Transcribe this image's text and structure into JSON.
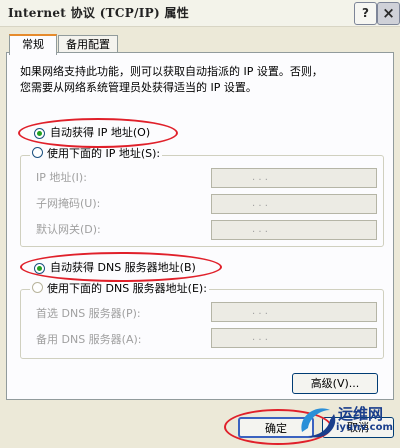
{
  "window": {
    "title": "Internet 协议 (TCP/IP) 属性",
    "help_button": "?",
    "close_button": "×"
  },
  "tabs": [
    {
      "label": "常规",
      "active": true
    },
    {
      "label": "备用配置",
      "active": false
    }
  ],
  "description": [
    "如果网络支持此功能，则可以获取自动指派的 IP 设置。否则，",
    "您需要从网络系统管理员处获得适当的 IP 设置。"
  ],
  "ip_section": {
    "auto_option": {
      "label": "自动获得 IP 地址(O)",
      "selected": true
    },
    "manual_option": {
      "label": "使用下面的 IP 地址(S):",
      "selected": false
    },
    "fields": [
      {
        "label": "IP 地址(I):",
        "value": ". . ."
      },
      {
        "label": "子网掩码(U):",
        "value": ". . ."
      },
      {
        "label": "默认网关(D):",
        "value": ". . ."
      }
    ]
  },
  "dns_section": {
    "auto_option": {
      "label": "自动获得 DNS 服务器地址(B)",
      "selected": true
    },
    "manual_option": {
      "label": "使用下面的 DNS 服务器地址(E):",
      "selected": false
    },
    "fields": [
      {
        "label": "首选 DNS 服务器(P):",
        "value": ". . ."
      },
      {
        "label": "备用 DNS 服务器(A):",
        "value": ". . ."
      }
    ]
  },
  "buttons": {
    "advanced": "高级(V)...",
    "ok": "确定",
    "cancel": "取消"
  },
  "watermark": {
    "name": "运维网",
    "site": "iyunv.com"
  },
  "colors": {
    "highlight_ellipse": "#e0202a",
    "radio_selected": "#21a121",
    "tab_accent": "#e68b2c",
    "window_bg": "#ece9d8"
  }
}
